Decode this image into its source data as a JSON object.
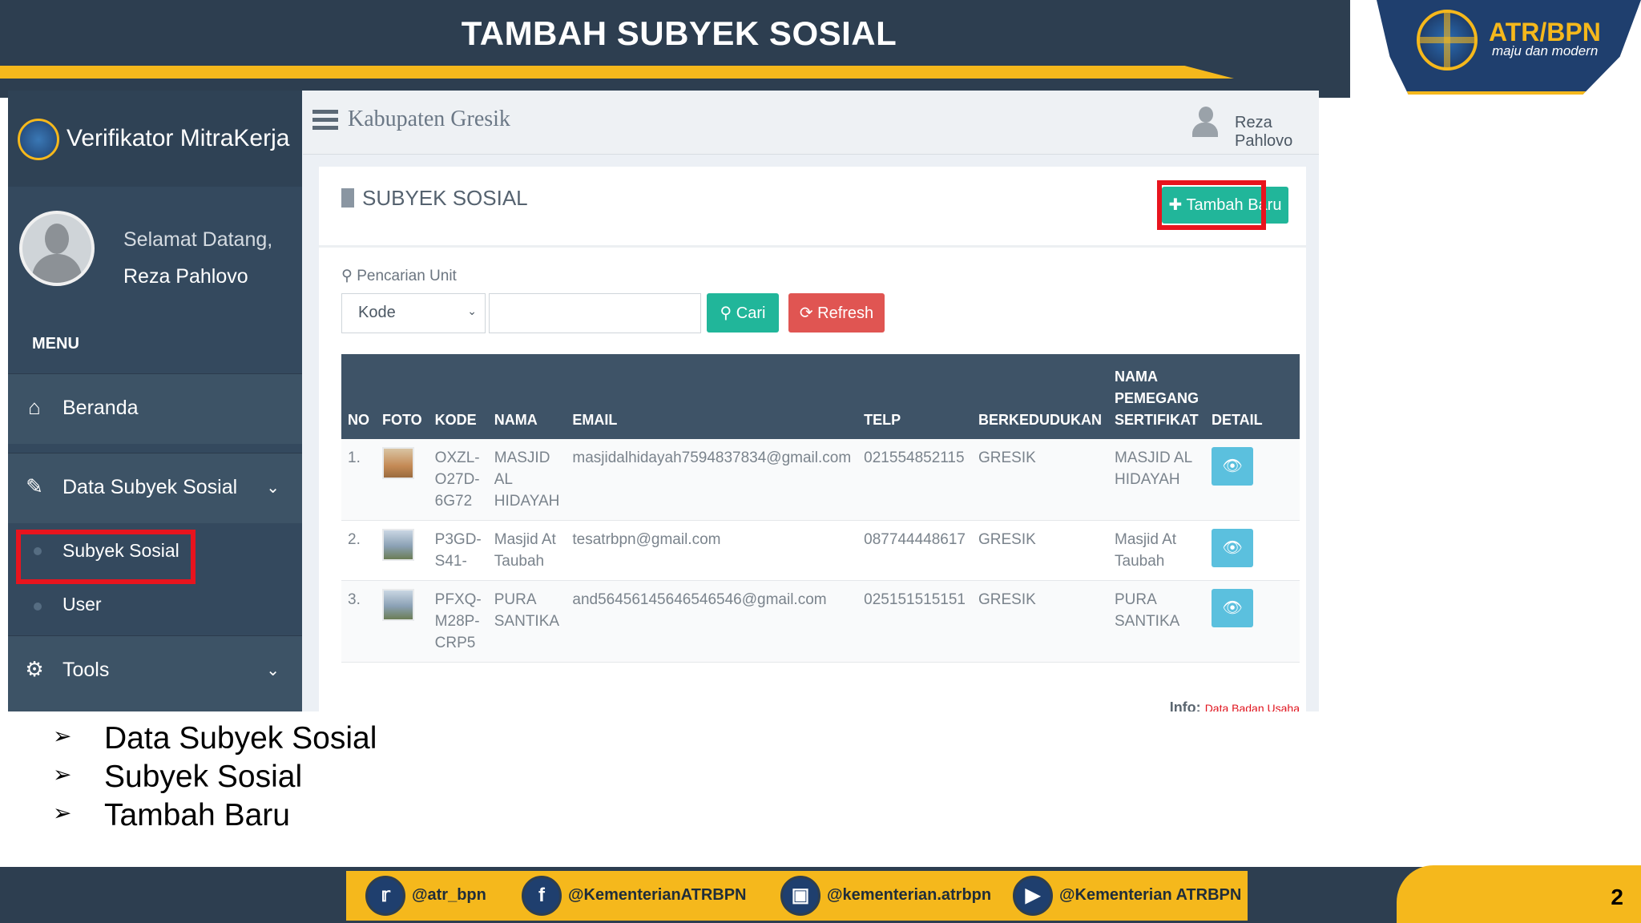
{
  "slide": {
    "title": "TAMBAH SUBYEK SOSIAL",
    "logo_text": "ATR/BPN",
    "logo_tagline": "maju dan modern",
    "page_number": "2",
    "colors": {
      "navy": "#2d3e50",
      "gold": "#f5b81c",
      "highlight": "#e8141e"
    }
  },
  "app": {
    "brand": "Verifikator MitraKerja",
    "welcome": "Selamat Datang,",
    "user_name": "Reza Pahlovo",
    "menu_label": "MENU",
    "sidebar": [
      {
        "label": "Beranda",
        "icon": "home-icon"
      },
      {
        "label": "Data Subyek Sosial",
        "icon": "edit-icon"
      },
      {
        "label": "Subyek Sosial"
      },
      {
        "label": "User"
      },
      {
        "label": "Tools",
        "icon": "gear-icon"
      }
    ],
    "topbar": {
      "location": "Kabupaten Gresik",
      "user": "Reza Pahlovo"
    },
    "panel": {
      "title": "SUBYEK SOSIAL",
      "add_button": "Tambah Baru",
      "search_label": "Pencarian Unit",
      "select_value": "Kode",
      "search_value": "",
      "search_button": "Cari",
      "refresh_button": "Refresh"
    },
    "table": {
      "headers": [
        "NO",
        "FOTO",
        "KODE",
        "NAMA",
        "EMAIL",
        "TELP",
        "BERKEDUDUKAN",
        "NAMA PEMEGANG SERTIFIKAT",
        "DETAIL"
      ],
      "rows": [
        {
          "no": "1.",
          "kode": "OXZL-O27D-6G72",
          "nama": "MASJID AL HIDAYAH",
          "email": "masjidalhidayah7594837834@gmail.com",
          "telp": "021554852115",
          "kedudukan": "GRESIK",
          "pemegang": "MASJID AL HIDAYAH"
        },
        {
          "no": "2.",
          "kode": "P3GD-S41-",
          "nama": "Masjid At Taubah",
          "email": "tesatrbpn@gmail.com",
          "telp": "087744448617",
          "kedudukan": "GRESIK",
          "pemegang": "Masjid At Taubah"
        },
        {
          "no": "3.",
          "kode": "PFXQ-M28P-CRP5",
          "nama": "PURA SANTIKA",
          "email": "and56456145646546546@gmail.com",
          "telp": "025151515151",
          "kedudukan": "GRESIK",
          "pemegang": "PURA SANTIKA"
        }
      ]
    },
    "info_label": "Info:",
    "info_link": "Data Badan Usaha"
  },
  "bullets": [
    "Data Subyek Sosial",
    "Subyek Sosial",
    "Tambah Baru"
  ],
  "social": [
    {
      "handle": "@atr_bpn",
      "icon": "twitter-icon"
    },
    {
      "handle": "@KementerianATRBPN",
      "icon": "facebook-icon"
    },
    {
      "handle": "@kementerian.atrbpn",
      "icon": "instagram-icon"
    },
    {
      "handle": "@Kementerian ATRBPN",
      "icon": "youtube-icon"
    }
  ]
}
